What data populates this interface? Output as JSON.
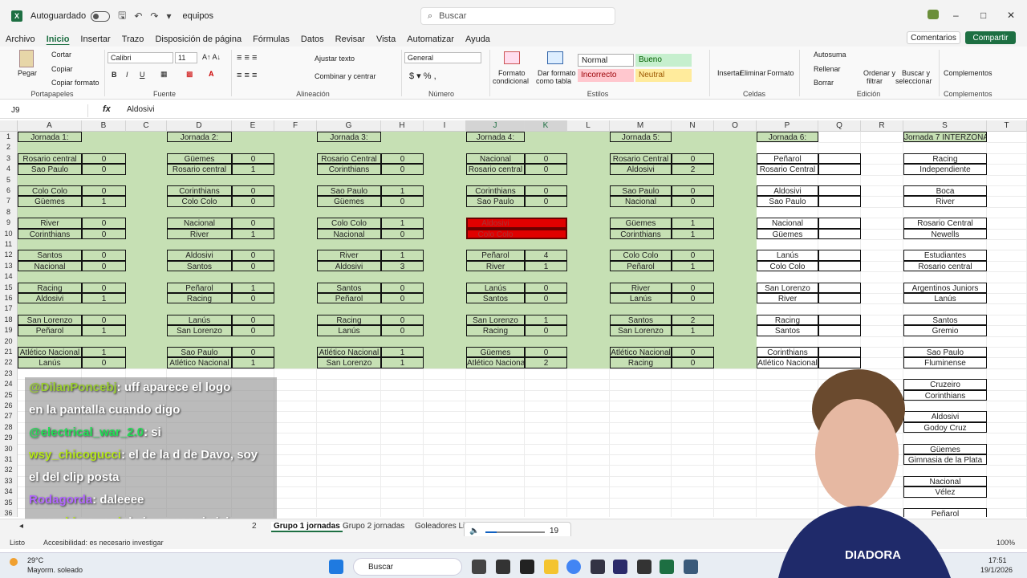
{
  "titlebar": {
    "autosave_label": "Autoguardado",
    "doc_name": "equipos",
    "search_placeholder": "Buscar"
  },
  "menu": [
    "Archivo",
    "Inicio",
    "Insertar",
    "Trazo",
    "Disposición de página",
    "Fórmulas",
    "Datos",
    "Revisar",
    "Vista",
    "Automatizar",
    "Ayuda"
  ],
  "menu_active": "Inicio",
  "buttons": {
    "comments": "Comentarios",
    "share": "Compartir"
  },
  "ribbon": {
    "paste": "Pegar",
    "cut": "Cortar",
    "copy": "Copiar",
    "copy_format": "Copiar formato",
    "clipboard": "Portapapeles",
    "font_name": "Calibri",
    "font_size": "11",
    "font_group": "Fuente",
    "wrap": "Ajustar texto",
    "merge": "Combinar y centrar",
    "align_group": "Alineación",
    "number_format": "General",
    "number_group": "Número",
    "cond_format": "Formato",
    "cond_format2": "condicional",
    "format_table": "Dar formato",
    "format_table2": "como tabla",
    "style_normal": "Normal",
    "style_good": "Bueno",
    "style_bad": "Incorrecto",
    "style_neutral": "Neutral",
    "styles_group": "Estilos",
    "insert": "Insertar",
    "delete": "Eliminar",
    "format": "Formato",
    "cells_group": "Celdas",
    "autosum": "Autosuma",
    "fill": "Rellenar",
    "clear": "Borrar",
    "sort": "Ordenar y",
    "sort2": "filtrar",
    "find": "Buscar y",
    "find2": "seleccionar",
    "edit_group": "Edición",
    "addins": "Complementos",
    "addins_group": "Complementos"
  },
  "formula": {
    "cell_ref": "J9",
    "fx": "fx",
    "value": "Aldosivi"
  },
  "columns": [
    "A",
    "B",
    "C",
    "D",
    "E",
    "F",
    "G",
    "H",
    "I",
    "J",
    "K",
    "L",
    "M",
    "N",
    "O",
    "P",
    "Q",
    "R",
    "S",
    "T"
  ],
  "rows": [
    "1",
    "2",
    "3",
    "4",
    "5",
    "6",
    "7",
    "8",
    "9",
    "10",
    "11",
    "12",
    "13",
    "14",
    "15",
    "16",
    "17",
    "18",
    "19",
    "20",
    "21",
    "22",
    "23",
    "24",
    "25",
    "26",
    "27",
    "28",
    "29",
    "30",
    "31",
    "32",
    "33",
    "34",
    "35",
    "36"
  ],
  "jornadas": [
    {
      "title": "Jornada 1:",
      "matches": [
        [
          "Rosario central",
          "0",
          "Sao Paulo",
          "0"
        ],
        [
          "Colo Colo",
          "0",
          "Güemes",
          "1"
        ],
        [
          "River",
          "0",
          "Corinthians",
          "0"
        ],
        [
          "Santos",
          "0",
          "Nacional",
          "0"
        ],
        [
          "Racing",
          "0",
          "Aldosivi",
          "1"
        ],
        [
          "San Lorenzo",
          "0",
          "Peñarol",
          "1"
        ],
        [
          "Atlético Nacional",
          "1",
          "Lanús",
          "0"
        ]
      ]
    },
    {
      "title": "Jornada 2:",
      "matches": [
        [
          "Güemes",
          "0",
          "Rosario central",
          "1"
        ],
        [
          "Corinthians",
          "0",
          "Colo Colo",
          "0"
        ],
        [
          "Nacional",
          "0",
          "River",
          "1"
        ],
        [
          "Aldosivi",
          "0",
          "Santos",
          "0"
        ],
        [
          "Peñarol",
          "1",
          "Racing",
          "0"
        ],
        [
          "Lanús",
          "0",
          "San Lorenzo",
          "0"
        ],
        [
          "Sao Paulo",
          "0",
          "Atlético Nacional",
          "1"
        ]
      ]
    },
    {
      "title": "Jornada 3:",
      "matches": [
        [
          "Rosario Central",
          "0",
          "Corinthians",
          "0"
        ],
        [
          "Sao Paulo",
          "1",
          "Güemes",
          "0"
        ],
        [
          "Colo Colo",
          "1",
          "Nacional",
          "0"
        ],
        [
          "River",
          "1",
          "Aldosivi",
          "3"
        ],
        [
          "Santos",
          "0",
          "Peñarol",
          "0"
        ],
        [
          "Racing",
          "0",
          "Lanús",
          "0"
        ],
        [
          "Atlético Nacional",
          "1",
          "San Lorenzo",
          "1"
        ]
      ]
    },
    {
      "title": "Jornada 4:",
      "matches": [
        [
          "Nacional",
          "0",
          "Rosario central",
          "0"
        ],
        [
          "Corinthians",
          "0",
          "Sao Paulo",
          "0"
        ],
        [
          "Aldosivi",
          "",
          "Colo Colo",
          ""
        ],
        [
          "Peñarol",
          "4",
          "River",
          "1"
        ],
        [
          "Lanús",
          "0",
          "Santos",
          "0"
        ],
        [
          "San Lorenzo",
          "1",
          "Racing",
          "0"
        ],
        [
          "Güemes",
          "0",
          "Atlético Nacional",
          "2"
        ]
      ]
    },
    {
      "title": "Jornada 5:",
      "matches": [
        [
          "Rosario Central",
          "0",
          "Aldosivi",
          "2"
        ],
        [
          "Sao Paulo",
          "0",
          "Nacional",
          "0"
        ],
        [
          "Güemes",
          "1",
          "Corinthians",
          "1"
        ],
        [
          "Colo Colo",
          "0",
          "Peñarol",
          "1"
        ],
        [
          "River",
          "0",
          "Lanús",
          "0"
        ],
        [
          "Santos",
          "2",
          "San Lorenzo",
          "1"
        ],
        [
          "Atlético Nacional",
          "0",
          "Racing",
          "0"
        ]
      ]
    },
    {
      "title": "Jornada 6:",
      "matches": [
        [
          "Peñarol",
          "",
          "Rosario Central",
          ""
        ],
        [
          "Aldosivi",
          "",
          "Sao Paulo",
          ""
        ],
        [
          "Nacional",
          "",
          "Güemes",
          ""
        ],
        [
          "Lanús",
          "",
          "Colo Colo",
          ""
        ],
        [
          "San Lorenzo",
          "",
          "River",
          ""
        ],
        [
          "Racing",
          "",
          "Santos",
          ""
        ],
        [
          "Corinthians",
          "",
          "Atlético Nacional",
          ""
        ]
      ]
    }
  ],
  "interzonal": {
    "title": "Jornada 7 INTERZONAL:",
    "matches": [
      [
        "Racing",
        "Independiente"
      ],
      [
        "Boca",
        "River"
      ],
      [
        "Rosario Central",
        "Newells"
      ],
      [
        "Estudiantes",
        "Rosario central"
      ],
      [
        "Argentinos Juniors",
        "Lanús"
      ],
      [
        "Santos",
        "Gremio"
      ],
      [
        "Sao Paulo",
        "Fluminense"
      ],
      [
        "Cruzeiro",
        "Corinthians"
      ],
      [
        "Aldosivi",
        "Godoy Cruz"
      ],
      [
        "Güemes",
        "Gimnasia de la Plata"
      ],
      [
        "Nacional",
        "Vélez"
      ],
      [
        "Peñarol",
        ""
      ]
    ]
  },
  "chat": [
    {
      "user": "@DilanPoncebj",
      "user_color": "#9acd32",
      "text": ": uff aparece el logo"
    },
    {
      "user": "",
      "user_color": "#fff",
      "text": "en la pantalla cuando digo"
    },
    {
      "user": "@electrical_war_2.0",
      "user_color": "#22dd55",
      "text": ": si"
    },
    {
      "user": "wsy_chicogucci",
      "user_color": "#b5e61d",
      "text": ": el de la d de Davo, soy"
    },
    {
      "user": "",
      "user_color": "#fff",
      "text": "el del clip posta"
    },
    {
      "user": "Rodagorda",
      "user_color": "#b266ff",
      "text": ": daleeee"
    },
    {
      "user": "wsy_chicogucci",
      "user_color": "#b5e61d",
      "text": ": lo juro por mi vieja"
    }
  ],
  "sheet_tabs": [
    "Grupo 1 jornadas",
    "Grupo 2 jornadas",
    "Goleadores Lig"
  ],
  "sheet_tab_active": "Grupo 1 jornadas",
  "sheet_tab_partial": "2",
  "volume": "19",
  "status": {
    "ready": "Listo",
    "accessibility": "Accesibilidad: es necesario investigar",
    "zoom": "100%"
  },
  "taskbar": {
    "temp": "29°C",
    "weather": "Mayorm. soleado",
    "search": "Buscar",
    "time": "17:51",
    "date": "19/1/2026"
  },
  "webcam_shirt_text": "DIADORA",
  "colors": {
    "excel_green": "#1d6f42",
    "cell_green": "#c6e0b4",
    "selection_red": "#e00000"
  }
}
